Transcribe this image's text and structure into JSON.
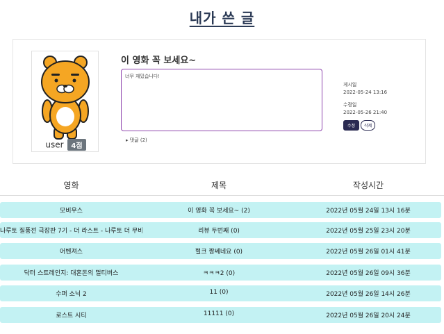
{
  "page": {
    "title": "내가 쓴 글"
  },
  "post": {
    "title": "이 영화 꼭 보세요~",
    "content": "너무 재밌습니다!",
    "comments_toggle": "▸ 댓글 (2)",
    "user_name": "user",
    "level": "4점",
    "posted_label": "게시일",
    "posted_value": "2022-05-24 13:16",
    "edited_label": "수정일",
    "edited_value": "2022-05-26 21:40",
    "edit_button": "수정",
    "delete_button": "삭제"
  },
  "table": {
    "columns": [
      "영화",
      "제목",
      "작성시간"
    ],
    "rows": [
      {
        "movie": "모비우스",
        "title": "이 영화 꼭 보세요~ (2)",
        "time": "2022년 05월 24일 13시 16분"
      },
      {
        "movie": "나루토 질풍전 극장판 7기 - 더 라스트 - 나루토 더 무비",
        "title": "리뷰 두번째 (0)",
        "time": "2022년 05월 25일 23시 20분"
      },
      {
        "movie": "어벤져스",
        "title": "헐크 짱쎄네요 (0)",
        "time": "2022년 05월 26일 01시 41분"
      },
      {
        "movie": "닥터 스트레인지: 대혼돈의 멀티버스",
        "title": "ㅋㅋㅋ2 (0)",
        "time": "2022년 05월 26일 09시 36분"
      },
      {
        "movie": "수퍼 소닉 2",
        "title": "11 (0)",
        "time": "2022년 05월 26일 14시 26분"
      },
      {
        "movie": "로스트 시티",
        "title": "11111 (0)",
        "time": "2022년 05월 26일 20시 24분"
      }
    ]
  },
  "colors": {
    "row_bg": "#c3f2f3",
    "accent": "#2b2b52",
    "content_border": "#8e44ad"
  }
}
